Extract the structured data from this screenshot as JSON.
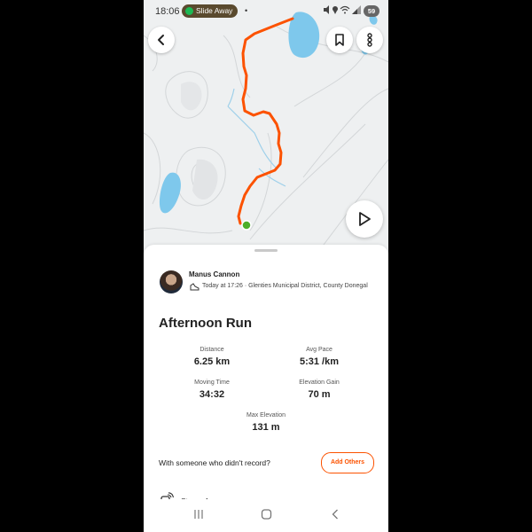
{
  "status_bar": {
    "time": "18:06",
    "media_pill": "Slide Away",
    "notification_dot": "•",
    "icons": [
      "mute-icon",
      "location-icon",
      "wifi-icon",
      "signal-icon"
    ],
    "battery": "59"
  },
  "map": {
    "icons": {
      "back": "chevron-left-icon",
      "save": "bookmark-icon",
      "more": "more-vertical-icon",
      "play": "play-icon"
    },
    "colors": {
      "route": "#fc5200",
      "water": "#7ec8ec",
      "start": "#4caf2b",
      "background": "#eef0f1"
    }
  },
  "athlete": {
    "name": "Manus Cannon",
    "subtitle": "Today at 17:26 · Glenties Municipal District, County Donegal",
    "sport_icon": "running-shoe-icon"
  },
  "activity": {
    "title": "Afternoon Run",
    "stats": [
      {
        "label": "Distance",
        "value": "6.25 km"
      },
      {
        "label": "Avg Pace",
        "value": "5:31 /km"
      },
      {
        "label": "Moving Time",
        "value": "34:32"
      },
      {
        "label": "Elevation Gain",
        "value": "70 m"
      },
      {
        "label": "Max Elevation",
        "value": "131 m"
      }
    ]
  },
  "with_others": {
    "text": "With someone who didn't record?",
    "button": "Add Others"
  },
  "device": {
    "icon": "watch-icon",
    "label": "Strava App"
  },
  "nav": {
    "icons": [
      "recents-icon",
      "home-icon",
      "back-icon"
    ]
  },
  "brand_color": "#fc5200"
}
